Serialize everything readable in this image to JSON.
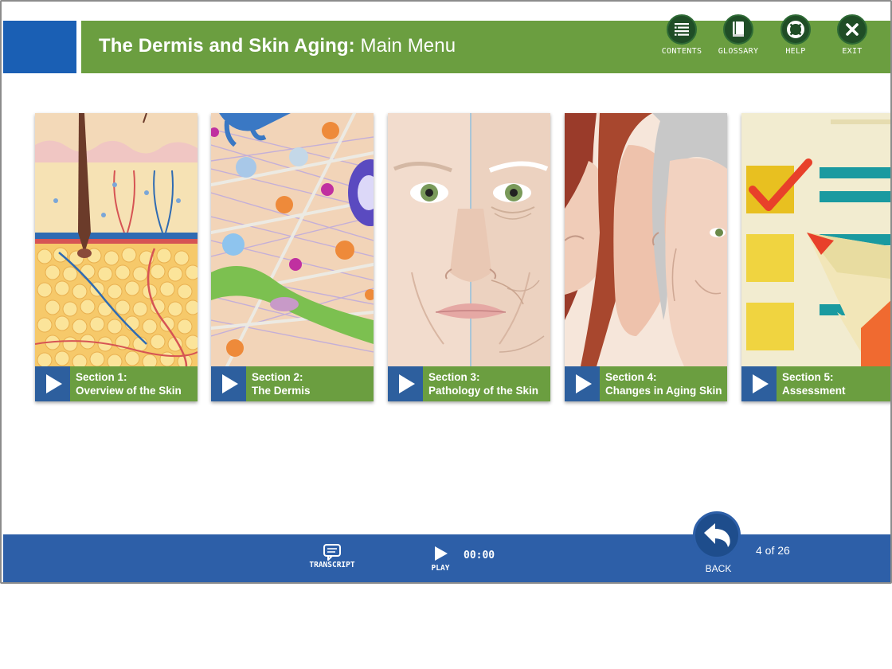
{
  "header": {
    "title_bold": "The Dermis and Skin Aging:",
    "title_light": "Main Menu",
    "buttons": [
      {
        "label": "CONTENTS",
        "icon": "list-icon"
      },
      {
        "label": "GLOSSARY",
        "icon": "book-icon"
      },
      {
        "label": "HELP",
        "icon": "lifebuoy-icon"
      },
      {
        "label": "EXIT",
        "icon": "close-icon"
      }
    ]
  },
  "sections": [
    {
      "line1": "Section 1:",
      "line2": "Overview of the Skin"
    },
    {
      "line1": "Section 2:",
      "line2": "The Dermis"
    },
    {
      "line1": "Section 3:",
      "line2": "Pathology of the Skin"
    },
    {
      "line1": "Section 4:",
      "line2": "Changes in Aging Skin"
    },
    {
      "line1": "Section 5:",
      "line2": "Assessment"
    }
  ],
  "footer": {
    "transcript_label": "TRANSCRIPT",
    "play_label": "PLAY",
    "time": "00:00",
    "back_label": "BACK",
    "page_count": "4 of 26"
  },
  "colors": {
    "header_green": "#6b9e40",
    "brand_blue": "#1a5fb4",
    "footer_blue": "#2d5fa8",
    "play_square": "#2d5f9e"
  }
}
